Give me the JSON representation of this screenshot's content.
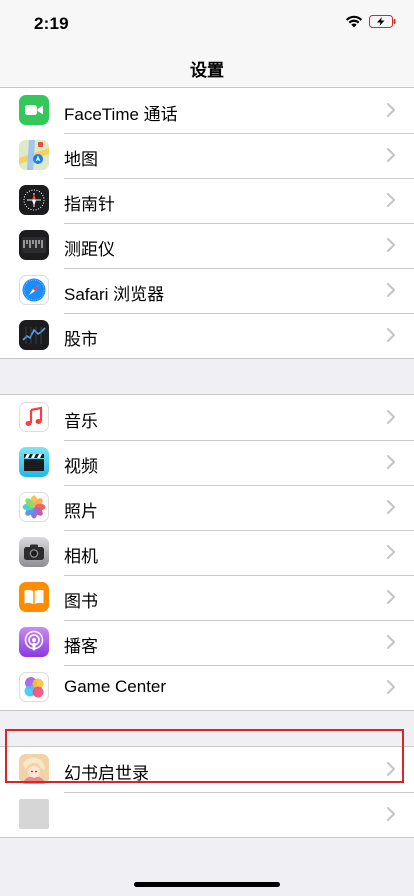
{
  "status_bar": {
    "time": "2:19"
  },
  "nav": {
    "title": "设置"
  },
  "groups": [
    {
      "rows": [
        {
          "label": "FaceTime 通话",
          "icon": "facetime-icon",
          "color": "#34c759"
        },
        {
          "label": "地图",
          "icon": "maps-icon",
          "color": "#6cc644"
        },
        {
          "label": "指南针",
          "icon": "compass-icon",
          "color": "#1c1c1e"
        },
        {
          "label": "测距仪",
          "icon": "measure-icon",
          "color": "#1c1c1e"
        },
        {
          "label": "Safari 浏览器",
          "icon": "safari-icon",
          "color": "#1a8cff"
        },
        {
          "label": "股市",
          "icon": "stocks-icon",
          "color": "#1c1c1e"
        }
      ]
    },
    {
      "rows": [
        {
          "label": "音乐",
          "icon": "music-icon",
          "color": "#fc3c44"
        },
        {
          "label": "视频",
          "icon": "videos-icon",
          "color": "#2cc6ea"
        },
        {
          "label": "照片",
          "icon": "photos-icon",
          "color": "#ffffff"
        },
        {
          "label": "相机",
          "icon": "camera-icon",
          "color": "#8e8e93"
        },
        {
          "label": "图书",
          "icon": "books-icon",
          "color": "#ff8c00"
        },
        {
          "label": "播客",
          "icon": "podcasts-icon",
          "color": "#a64fe8"
        },
        {
          "label": "Game Center",
          "icon": "game-center-icon",
          "color": "#ffffff"
        }
      ]
    },
    {
      "rows": [
        {
          "label": "幻书启世录",
          "icon": "huanshu-app-icon",
          "color": "#f4c28b"
        },
        {
          "label": "",
          "icon": "blank-app-icon",
          "color": "#d6d6d6"
        }
      ]
    }
  ]
}
